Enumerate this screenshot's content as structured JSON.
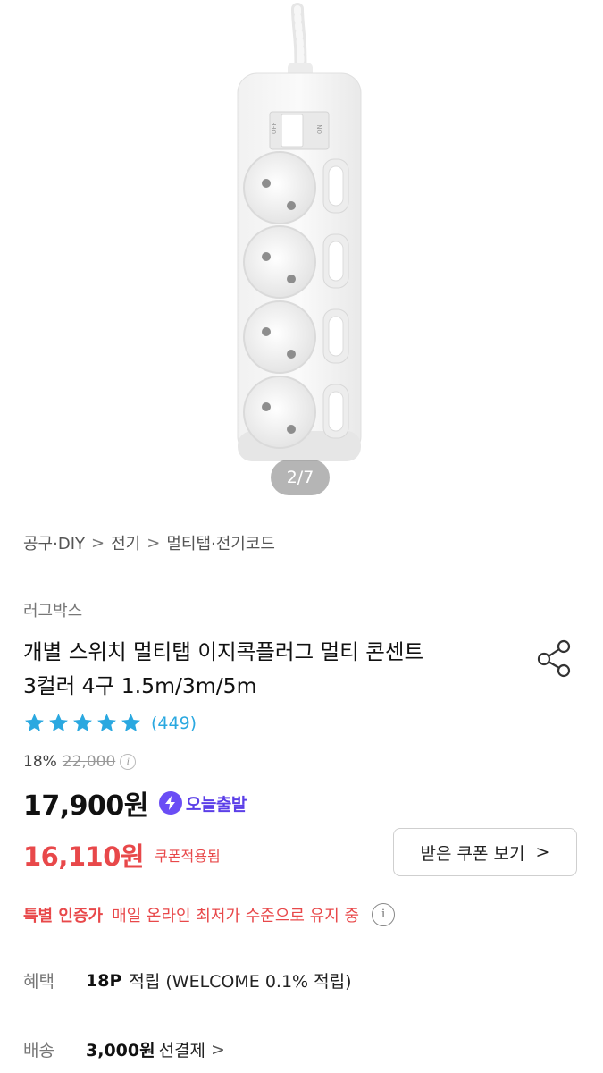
{
  "gallery": {
    "counter": "2/7",
    "image_alt": "multi-tap product image"
  },
  "breadcrumb": [
    "공구·DIY",
    "전기",
    "멀티탭·전기코드"
  ],
  "product": {
    "brand": "러그박스",
    "title_line1": "개별 스위치 멀티탭 이지콕플러그 멀티 콘센트",
    "title_line2": "3컬러 4구 1.5m/3m/5m",
    "rating_stars": 5,
    "review_count": "(449)",
    "discount_rate": "18%",
    "original_price": "22,000",
    "price": "17,900원",
    "delivery_badge": "오늘출발",
    "coupon_price": "16,110원",
    "coupon_applied_label": "쿠폰적용됨",
    "coupon_button_label": "받은 쿠폰 보기"
  },
  "special": {
    "label": "특별 인증가",
    "text": "매일 온라인 최저가 수준으로 유지 중"
  },
  "benefit": {
    "label": "혜택",
    "points": "18P",
    "text": "적립 (WELCOME 0.1% 적립)"
  },
  "shipping": {
    "label": "배송",
    "fee": "3,000원",
    "type": "선결제"
  },
  "colors": {
    "accent_red": "#e8484a",
    "star_blue": "#2aa8e0",
    "badge_purple": "#5b3fe8"
  }
}
